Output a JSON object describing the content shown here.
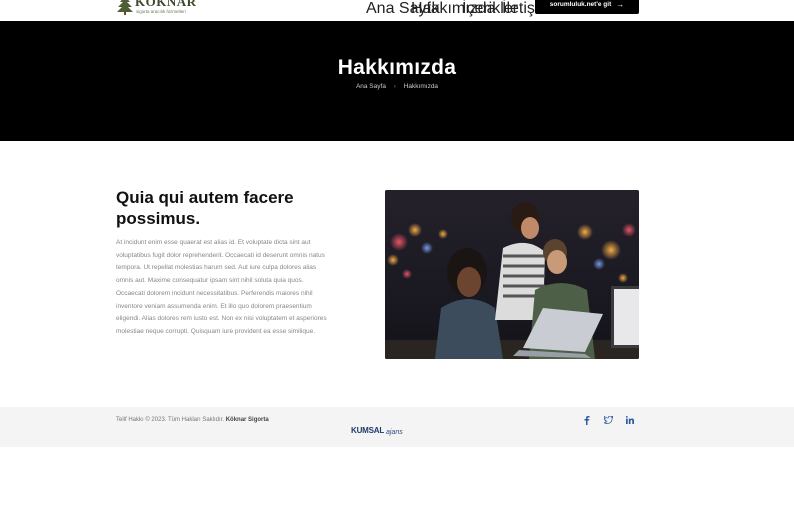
{
  "header": {
    "brand": "KÖKNAR",
    "tagline": "sigorta aracılık hizmetleri",
    "nav": [
      "Ana Sayfa",
      "Hakkımızda",
      "İçerikler",
      "İletişim"
    ],
    "cta_label": "sorumluluk.net'e git"
  },
  "hero": {
    "title": "Hakkımızda",
    "breadcrumb": [
      "Ana Sayfa",
      "Hakkımızda"
    ]
  },
  "content": {
    "title": "Quia qui autem facere possimus.",
    "body": "At incidunt enim esse quaerat est alias id. Et voluptate dicta sint aut voluptatibus fugit dolor reprehenderit. Occaecati id deserunt omnis natus tempora. Ut repellat molestias harum sed. Aut iure culpa dolores alias omnis aut. Maxime consequatur ipsam sint nihil soluta quia quos. Occaecati dolorem incidunt necessitatibus. Perferendis maiores nihil inventore veniam assumenda enim. Et illo quo dolorem praesentium eligendi. Alias dolores rem iusto est. Non ex nisi voluptatem et asperiores molestiae neque corrupti. Quisquam iure provident ea esse similique."
  },
  "footer": {
    "copyright_prefix": "Telif Hakkı © 2023. Tüm Hakları Saklıdır.",
    "copyright_company": "Köknar Sigorta",
    "agency_main": "KUMSAL",
    "agency_sub": "ajans"
  },
  "colors": {
    "hero_bg": "#000000",
    "footer_bg": "#f4f4f4",
    "social": "#2b5aa6",
    "agency": "#1e3a6b"
  },
  "icons": [
    "tree-logo-icon",
    "arrow-right-icon",
    "facebook-icon",
    "twitter-icon",
    "linkedin-icon"
  ]
}
